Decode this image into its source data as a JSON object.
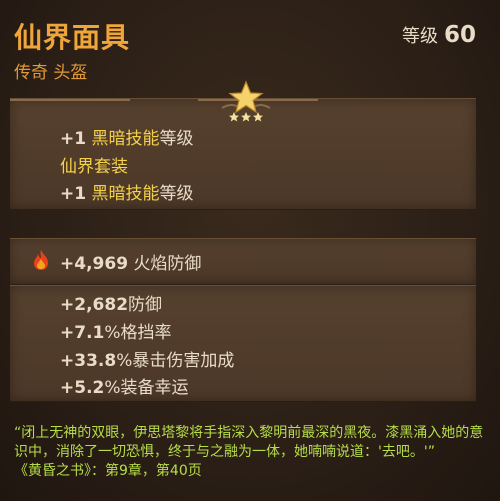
{
  "item": {
    "name": "仙界面具",
    "rarity_slot": "传奇 头盔",
    "level_label": "等级",
    "level_value": "60"
  },
  "skill_bonuses": {
    "line1": {
      "prefix": "+1",
      "highlight": "黑暗技能",
      "suffix": "等级"
    },
    "set_name": "仙界套装",
    "line2": {
      "prefix": "+1",
      "highlight": "黑暗技能",
      "suffix": "等级"
    }
  },
  "fire_defense": {
    "value": "+4,969",
    "label": "火焰防御"
  },
  "stats": [
    {
      "value": "+2,682",
      "label": "防御"
    },
    {
      "value": "+7.1",
      "label": "%格挡率"
    },
    {
      "value": "+33.8",
      "label": "%暴击伤害加成"
    },
    {
      "value": "+5.2",
      "label": "%装备幸运"
    }
  ],
  "lore": {
    "text": "“闭上无神的双眼，伊思塔黎将手指深入黎明前最深的黑夜。漆黑涌入她的意识中，消除了一切恐惧，终于与之融为一体，她喃喃说道：'去吧。'”",
    "source": "《黄昏之书》：第9章，第40页"
  },
  "colors": {
    "legendary": "#f0a53a",
    "skill_highlight": "#f4d14a",
    "lore_text": "#b7dd4a"
  },
  "icons": {
    "rank": "star-icon",
    "fire": "fire-icon"
  }
}
